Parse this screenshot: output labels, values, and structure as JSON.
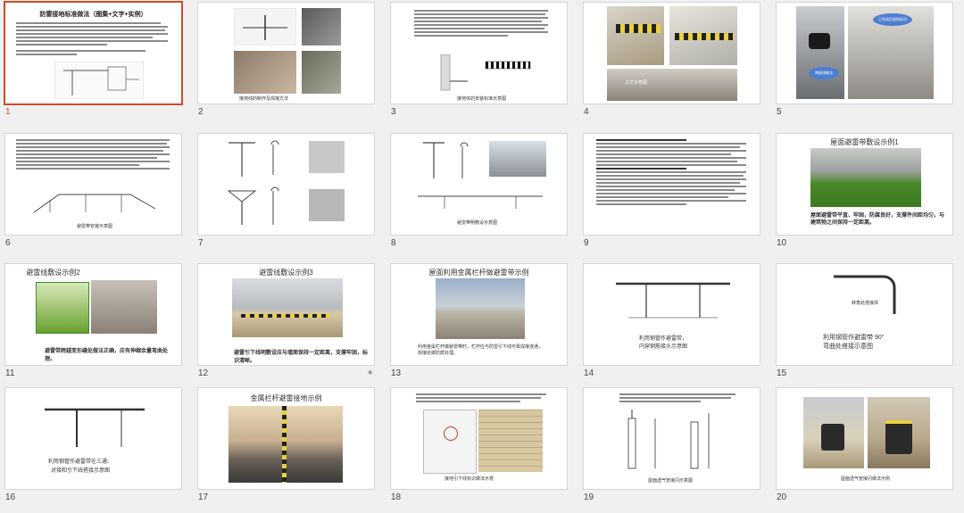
{
  "slides": [
    {
      "number": "1",
      "title": "防雷接地标准做法（图集+文字+实例）",
      "caption": "",
      "selected": true
    },
    {
      "number": "2",
      "title": "",
      "caption": "接地线的制作及焊接方法",
      "selected": false
    },
    {
      "number": "3",
      "title": "",
      "caption": "接地体的安装标准示意图",
      "selected": false
    },
    {
      "number": "4",
      "title": "",
      "caption": "工艺示意图",
      "selected": false
    },
    {
      "number": "5",
      "title": "",
      "caption": "",
      "callout1": "已完成后接地标识",
      "callout2": "跨接线做法",
      "selected": false
    },
    {
      "number": "6",
      "title": "",
      "caption": "避雷带安装示意图",
      "selected": false
    },
    {
      "number": "7",
      "title": "",
      "caption": "",
      "selected": false
    },
    {
      "number": "8",
      "title": "",
      "caption": "避雷带明敷设示意图",
      "selected": false
    },
    {
      "number": "9",
      "title": "",
      "caption": "",
      "selected": false
    },
    {
      "number": "10",
      "title": "屋面避雷带敷设示例1",
      "caption": "屋面避雷带平直、牢固，防腐良好，支撑件间距均匀，与建筑物之间保持一定距离。",
      "selected": false
    },
    {
      "number": "11",
      "title": "避雷线敷设示例2",
      "caption": "避雷带跨越变形缝处做法正确，应有伸缩余量弯曲处理。",
      "selected": false
    },
    {
      "number": "12",
      "title": "避雷线敷设示例3",
      "caption": "避雷引下线明敷设应与墙面保持一定距离，支撑牢固，标识清晰。",
      "selected": false,
      "star": "*"
    },
    {
      "number": "13",
      "title": "屋面利用金属栏杆做避雷带示例",
      "caption": "利用金属栏杆做避雷带时，栏杆应与防雷引下线可靠焊接连通，焊接处做防腐处理。",
      "selected": false
    },
    {
      "number": "14",
      "title": "",
      "caption": "利用钢管作避雷带，\n内穿钢筋接头示意图",
      "selected": false
    },
    {
      "number": "15",
      "title": "",
      "caption": "利用钢管作避雷带 90°\n弯曲处搭接示意图",
      "label": "转角处搭接焊",
      "selected": false
    },
    {
      "number": "16",
      "title": "",
      "caption": "利用钢管作避雷带在三通、\n对接和引下线搭接示意图",
      "selected": false
    },
    {
      "number": "17",
      "title": "金属栏杆避雷接地示例",
      "caption": "",
      "selected": false
    },
    {
      "number": "18",
      "title": "",
      "caption": "接地引下线标识做法示意",
      "selected": false
    },
    {
      "number": "19",
      "title": "",
      "caption": "屋面透气管接闪示意图",
      "selected": false
    },
    {
      "number": "20",
      "title": "",
      "caption": "屋面透气管接闪做法示例",
      "selected": false
    }
  ]
}
